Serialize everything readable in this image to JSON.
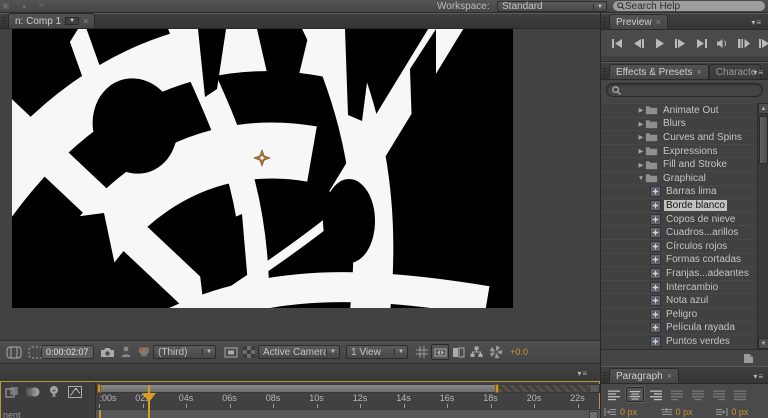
{
  "topbar": {
    "workspace_label": "Workspace:",
    "workspace_value": "Standard",
    "search_value": "Search Help"
  },
  "comp_panel": {
    "tab": "n: Comp 1",
    "toolbar": {
      "timecode": "0:00:02:07",
      "resolution": "(Third)",
      "camera_view": "Active Camera",
      "view_layout": "1 View",
      "exposure": "+0.0",
      "icons": [
        "safe-zones-icon",
        "region-of-interest-icon",
        "snapshot-camera-icon",
        "show-snapshot-icon",
        "show-channels-icon",
        "mask-visibility-icon",
        "transparency-grid-icon",
        "grid-options-icon",
        "pixel-aspect-correction-icon",
        "fast-previews-icon",
        "flowchart-icon",
        "exposure-shutter-icon"
      ]
    }
  },
  "preview_panel": {
    "tab": "Preview",
    "buttons": [
      "first-frame",
      "previous-frame",
      "play",
      "next-frame",
      "last-frame",
      "mute-audio",
      "ram-preview",
      "shuttle-next"
    ]
  },
  "effects_panel": {
    "tab": "Effects & Presets",
    "tab_partial": "Characte",
    "search_value": "",
    "items": [
      {
        "label": "Animate Out",
        "type": "folder",
        "expanded": false
      },
      {
        "label": "Blurs",
        "type": "folder",
        "expanded": false
      },
      {
        "label": "Curves and Spins",
        "type": "folder",
        "expanded": false
      },
      {
        "label": "Expressions",
        "type": "folder",
        "expanded": false
      },
      {
        "label": "Fill and Stroke",
        "type": "folder",
        "expanded": false
      },
      {
        "label": "Graphical",
        "type": "folder",
        "expanded": true
      },
      {
        "label": "Barras lima",
        "type": "preset",
        "selected": false
      },
      {
        "label": "Borde blanco",
        "type": "preset",
        "selected": true
      },
      {
        "label": "Copos de nieve",
        "type": "preset",
        "selected": false
      },
      {
        "label": "Cuadros...arillos",
        "type": "preset",
        "selected": false
      },
      {
        "label": "Círculos rojos",
        "type": "preset",
        "selected": false
      },
      {
        "label": "Formas cortadas",
        "type": "preset",
        "selected": false
      },
      {
        "label": "Franjas...adeantes",
        "type": "preset",
        "selected": false
      },
      {
        "label": "Intercambio",
        "type": "preset",
        "selected": false
      },
      {
        "label": "Nota azul",
        "type": "preset",
        "selected": false
      },
      {
        "label": "Peligro",
        "type": "preset",
        "selected": false
      },
      {
        "label": "Película rayada",
        "type": "preset",
        "selected": false
      },
      {
        "label": "Puntos verdes",
        "type": "preset",
        "selected": false
      }
    ]
  },
  "paragraph_panel": {
    "tab": "Paragraph",
    "align_buttons": [
      "align-left",
      "align-center",
      "align-right",
      "justify-last-left",
      "justify-last-center",
      "justify-last-right",
      "justify-all"
    ],
    "selected_align": 1,
    "indent_left": "0 px",
    "indent_first_line": "0 px",
    "indent_right": "0 px"
  },
  "timeline_panel": {
    "ruler_ticks": [
      ":00s",
      "02s",
      "04s",
      "06s",
      "08s",
      "10s",
      "12s",
      "14s",
      "16s",
      "18s",
      "20s",
      "22s"
    ],
    "corner_fragment": "nent",
    "toggles": [
      "frame-blending-icon",
      "motion-blur-icon",
      "brainstorm-icon",
      "graph-editor-icon"
    ]
  },
  "colors": {
    "accent_orange": "#cd9733",
    "playhead_gold": "#d7a021",
    "selection_bg": "#c2c2c2",
    "active_panel_border": "#b29a42"
  }
}
